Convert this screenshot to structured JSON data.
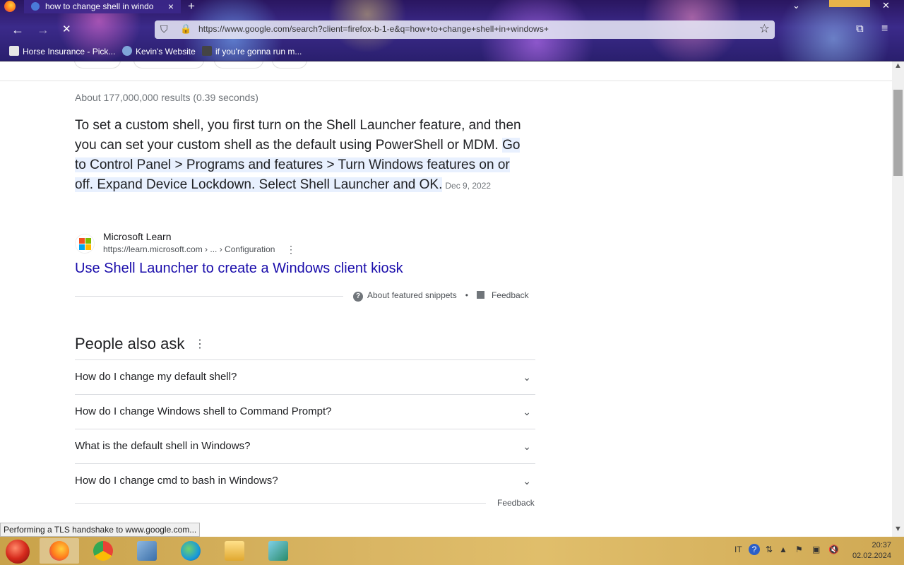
{
  "browser": {
    "tab_title": "how to change shell in windo",
    "new_tab": "+",
    "close_tab": "×",
    "url": "https://www.google.com/search?client=firefox-b-1-e&q=how+to+change+shell+in+windows+",
    "bookmarks": [
      {
        "label": "Horse Insurance - Pick...",
        "icon": "page-icon",
        "color": "#e6e6e6"
      },
      {
        "label": "Kevin's Website",
        "icon": "globe-icon",
        "color": "#7fa6d9"
      },
      {
        "label": "if you're gonna run m...",
        "icon": "ghost-icon",
        "color": "#444444"
      }
    ],
    "status": "Performing a TLS handshake to www.google.com..."
  },
  "search": {
    "result_stats": "About 177,000,000 results (0.39 seconds)",
    "snippet_plain": "To set a custom shell, you first turn on the Shell Launcher feature, and then you can set your custom shell as the default using PowerShell or MDM. ",
    "snippet_highlight": "Go to Control Panel > Programs and features > Turn Windows features on or off. Expand Device Lockdown. Select Shell Launcher and OK.",
    "snippet_date": "Dec 9, 2022",
    "source_name": "Microsoft Learn",
    "source_url": "https://learn.microsoft.com › ... › Configuration",
    "result_link": "Use Shell Launcher to create a Windows client kiosk",
    "about_snippets": "About featured snippets",
    "feedback": "Feedback",
    "paa_title": "People also ask",
    "paa_items": [
      "How do I change my default shell?",
      "How do I change Windows shell to Command Prompt?",
      "What is the default shell in Windows?",
      "How do I change cmd to bash in Windows?"
    ],
    "paa_feedback": "Feedback"
  },
  "taskbar": {
    "language": "IT",
    "time": "20:37",
    "date": "02.02.2024"
  }
}
